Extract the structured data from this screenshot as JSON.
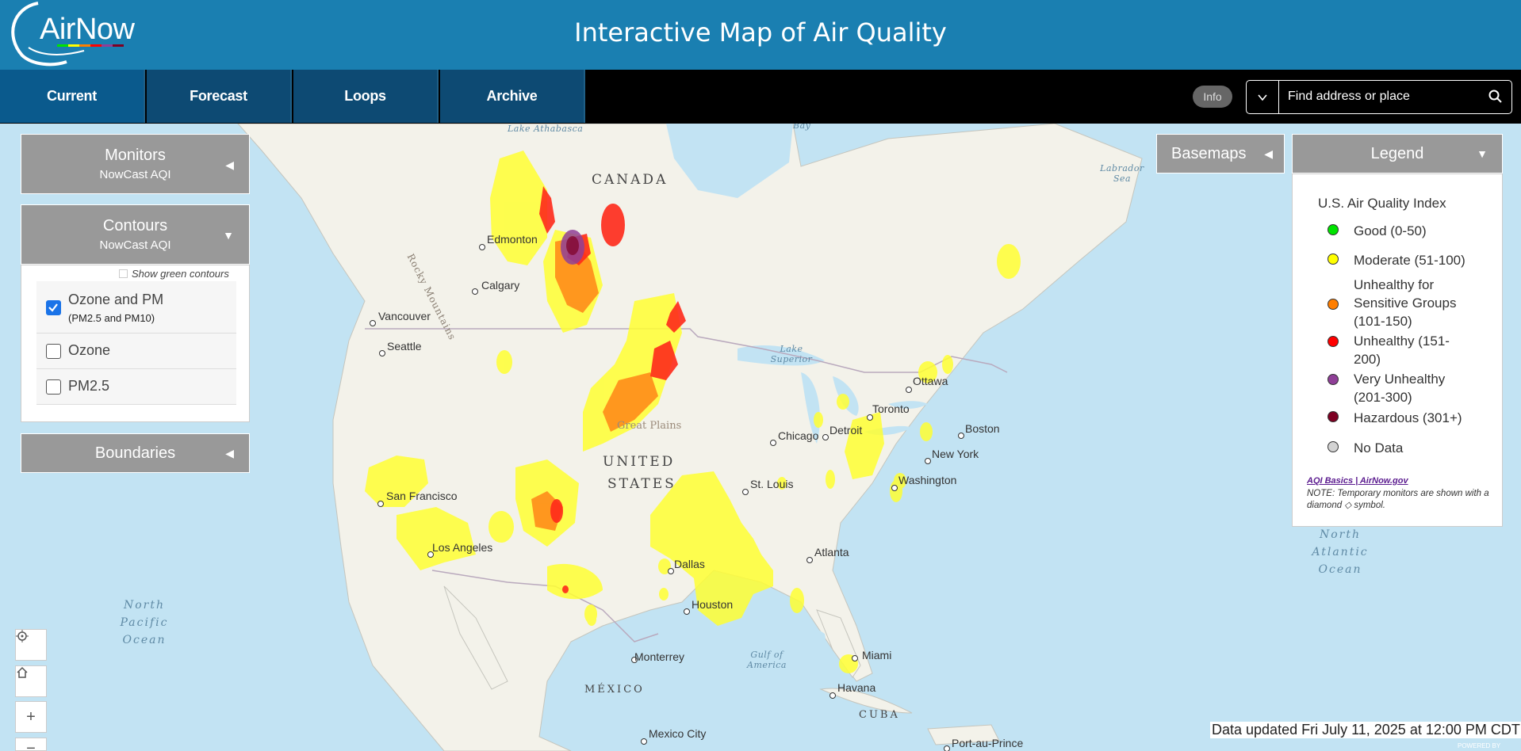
{
  "header": {
    "logo_text": "AirNow",
    "title": "Interactive Map of Air Quality"
  },
  "nav": {
    "tabs": [
      {
        "label": "Current",
        "active": true
      },
      {
        "label": "Forecast",
        "active": false
      },
      {
        "label": "Loops",
        "active": false
      },
      {
        "label": "Archive",
        "active": false
      }
    ],
    "info_label": "Info",
    "search_placeholder": "Find address or place"
  },
  "left_panels": {
    "monitors": {
      "title": "Monitors",
      "subtitle": "NowCast AQI"
    },
    "contours": {
      "title": "Contours",
      "subtitle": "NowCast AQI",
      "show_green": "Show green contours",
      "options": [
        {
          "label": "Ozone and PM",
          "sublabel": "(PM2.5 and PM10)",
          "checked": true
        },
        {
          "label": "Ozone",
          "checked": false
        },
        {
          "label": "PM2.5",
          "checked": false
        }
      ]
    },
    "boundaries": {
      "title": "Boundaries"
    }
  },
  "right_panels": {
    "basemaps": "Basemaps",
    "legend": {
      "title": "Legend",
      "index_title": "U.S. Air Quality Index",
      "items": [
        {
          "label": "Good (0-50)",
          "color": "#00e400"
        },
        {
          "label": "Moderate (51-100)",
          "color": "#ffff00"
        },
        {
          "label": "Unhealthy for Sensitive Groups (101-150)",
          "color": "#ff7e00"
        },
        {
          "label": "Unhealthy (151-200)",
          "color": "#ff0000"
        },
        {
          "label": "Very Unhealthy (201-300)",
          "color": "#8f3f97"
        },
        {
          "label": "Hazardous (301+)",
          "color": "#7e0023"
        },
        {
          "label": "No Data",
          "color": "#d3d3d3"
        }
      ],
      "link": "AQI Basics | AirNow.gov",
      "note": "NOTE: Temporary monitors are shown with a diamond ◇ symbol."
    }
  },
  "map": {
    "cities": [
      "Edmonton",
      "Calgary",
      "Vancouver",
      "Seattle",
      "San Francisco",
      "Los Angeles",
      "Dallas",
      "Houston",
      "Chicago",
      "Detroit",
      "Toronto",
      "Ottawa",
      "Boston",
      "New York",
      "Washington",
      "St. Louis",
      "Atlanta",
      "Miami",
      "Havana",
      "Monterrey",
      "Mexico City",
      "Port-au-Prince"
    ],
    "countries": [
      "CANADA",
      "UNITED",
      "STATES",
      "MÉXICO",
      "CUBA"
    ],
    "water": {
      "lake_athabasca": "Lake Athabasca",
      "bay": "Bay",
      "labrador_sea": "Labrador Sea",
      "lake_superior": "Lake Superior",
      "north_atlantic": "North Atlantic Ocean",
      "north_pacific": "North Pacific Ocean",
      "gulf": "Gulf of America"
    },
    "regions": {
      "great_plains": "Great Plains",
      "rocky": "Rocky Mountains"
    }
  },
  "status": {
    "data_updated": "Data updated Fri July 11, 2025 at 12:00 PM CDT",
    "powered_by": "POWERED BY"
  }
}
